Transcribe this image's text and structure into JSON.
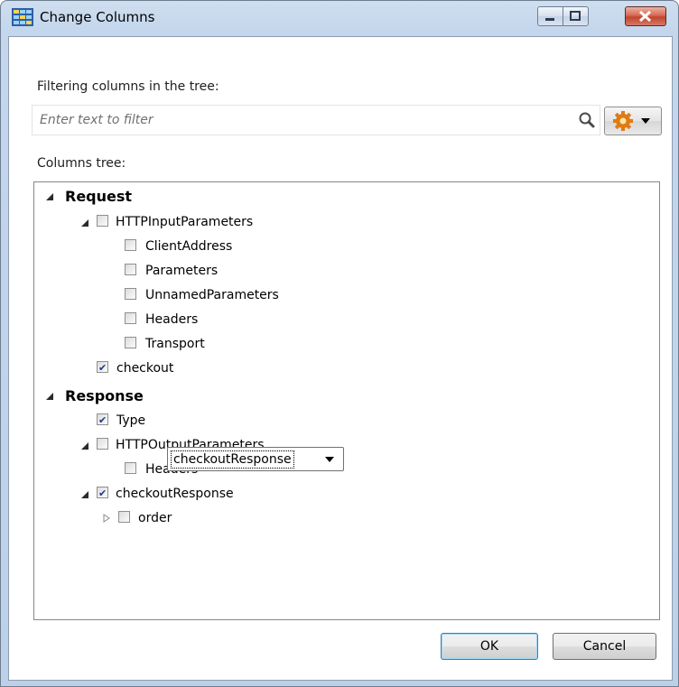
{
  "window": {
    "title": "Change Columns",
    "controls": [
      "minimize",
      "maximize",
      "close"
    ]
  },
  "filter": {
    "label": "Filtering columns in the tree:",
    "placeholder": "Enter text to filter",
    "value": "",
    "search_icon": "search-icon",
    "settings_icon": "gear-icon"
  },
  "tree": {
    "label": "Columns tree:",
    "request": {
      "label": "Request",
      "expanded": true,
      "http_input": {
        "label": "HTTPInputParameters",
        "checked": false,
        "children": [
          {
            "label": "ClientAddress",
            "checked": false
          },
          {
            "label": "Parameters",
            "checked": false
          },
          {
            "label": "UnnamedParameters",
            "checked": false
          },
          {
            "label": "Headers",
            "checked": false
          },
          {
            "label": "Transport",
            "checked": false
          }
        ]
      },
      "checkout": {
        "label": "checkout",
        "checked": true
      }
    },
    "response": {
      "label": "Response",
      "expanded": true,
      "type": {
        "label": "Type",
        "checked": true,
        "selected": "checkoutResponse"
      },
      "http_output": {
        "label": "HTTPOutputParameters",
        "checked": false,
        "children": [
          {
            "label": "Headers",
            "checked": false
          }
        ]
      },
      "checkout_response": {
        "label": "checkoutResponse",
        "checked": true,
        "children": [
          {
            "label": "order",
            "checked": false,
            "expanded": false
          }
        ]
      }
    }
  },
  "buttons": {
    "ok": "OK",
    "cancel": "Cancel"
  },
  "colors": {
    "frame": "#bcd1e9",
    "close_button": "#c2432c",
    "check": "#1a3b85",
    "default_button_border": "#3c7fb1"
  }
}
